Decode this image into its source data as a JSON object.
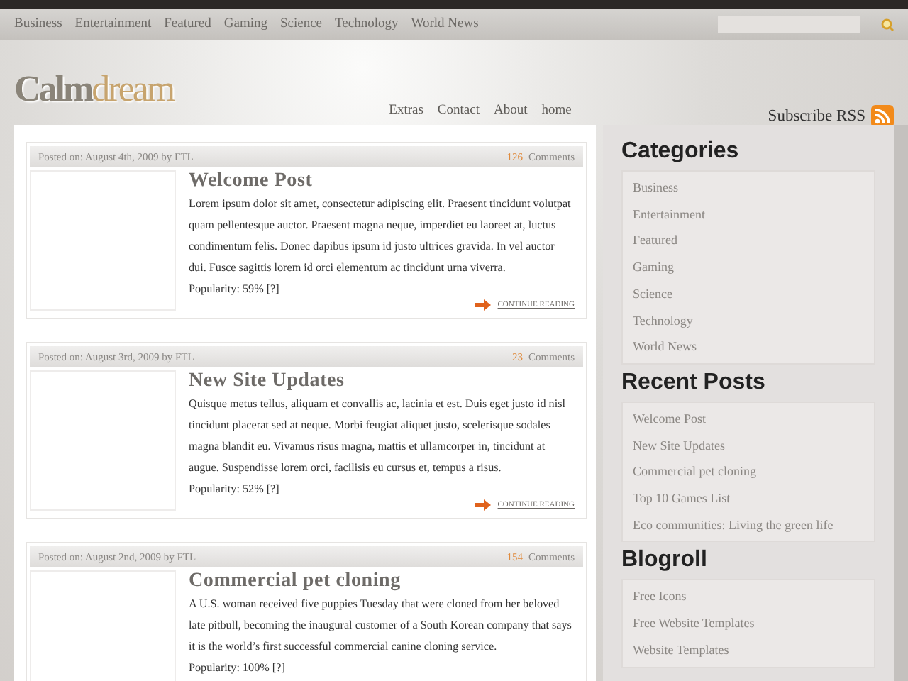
{
  "top_nav": [
    {
      "label": "Business"
    },
    {
      "label": "Entertainment"
    },
    {
      "label": "Featured"
    },
    {
      "label": "Gaming"
    },
    {
      "label": "Science"
    },
    {
      "label": "Technology"
    },
    {
      "label": "World News"
    }
  ],
  "logo": {
    "first": "Calm",
    "second": "dream"
  },
  "page_nav": [
    {
      "label": "Extras"
    },
    {
      "label": "Contact"
    },
    {
      "label": "About"
    },
    {
      "label": "home"
    }
  ],
  "subscribe": "Subscribe RSS",
  "posts": [
    {
      "meta": "Posted on: August 4th, 2009 by FTL",
      "comment_count": "126",
      "comments_label": "Comments",
      "title": "Welcome Post",
      "body": "Lorem ipsum dolor sit amet, consectetur adipiscing elit. Praesent tincidunt volutpat quam pellentesque auctor. Praesent magna neque, imperdiet eu laoreet at, luctus condimentum felis. Donec dapibus ipsum id justo ultrices gravida. In vel auctor dui. Fusce sagittis lorem id orci elementum ac tincidunt urna viverra.",
      "popularity": "Popularity: 59% [?]",
      "more": "CONTINUE READING"
    },
    {
      "meta": "Posted on: August 3rd, 2009 by FTL",
      "comment_count": "23",
      "comments_label": "Comments",
      "title": "New Site Updates",
      "body": "Quisque metus tellus, aliquam et convallis ac, lacinia et est. Duis eget justo id nisl tincidunt placerat sed at neque. Morbi feugiat aliquet justo, scelerisque sodales magna blandit eu. Vivamus risus magna, mattis et ullamcorper in, tincidunt at augue. Suspendisse lorem orci, facilisis eu cursus et, tempus a risus.",
      "popularity": "Popularity: 52% [?]",
      "more": "CONTINUE READING"
    },
    {
      "meta": "Posted on: August 2nd, 2009 by FTL",
      "comment_count": "154",
      "comments_label": "Comments",
      "title": "Commercial pet cloning",
      "body": "A U.S. woman received five puppies Tuesday that were cloned from her beloved late pitbull, becoming the inaugural customer of a South Korean company that says it is the world’s first successful commercial canine cloning service.",
      "popularity": "Popularity: 100% [?]"
    }
  ],
  "sidebar": [
    {
      "heading": "Categories",
      "items": [
        "Business",
        "Entertainment",
        "Featured",
        "Gaming",
        "Science",
        "Technology",
        "World News"
      ]
    },
    {
      "heading": "Recent Posts",
      "items": [
        "Welcome Post",
        "New Site Updates",
        "Commercial pet cloning",
        "Top 10 Games List",
        "Eco communities: Living the green life"
      ]
    },
    {
      "heading": "Blogroll",
      "items": [
        "Free Icons",
        "Free Website Templates",
        "Website Templates"
      ]
    }
  ]
}
